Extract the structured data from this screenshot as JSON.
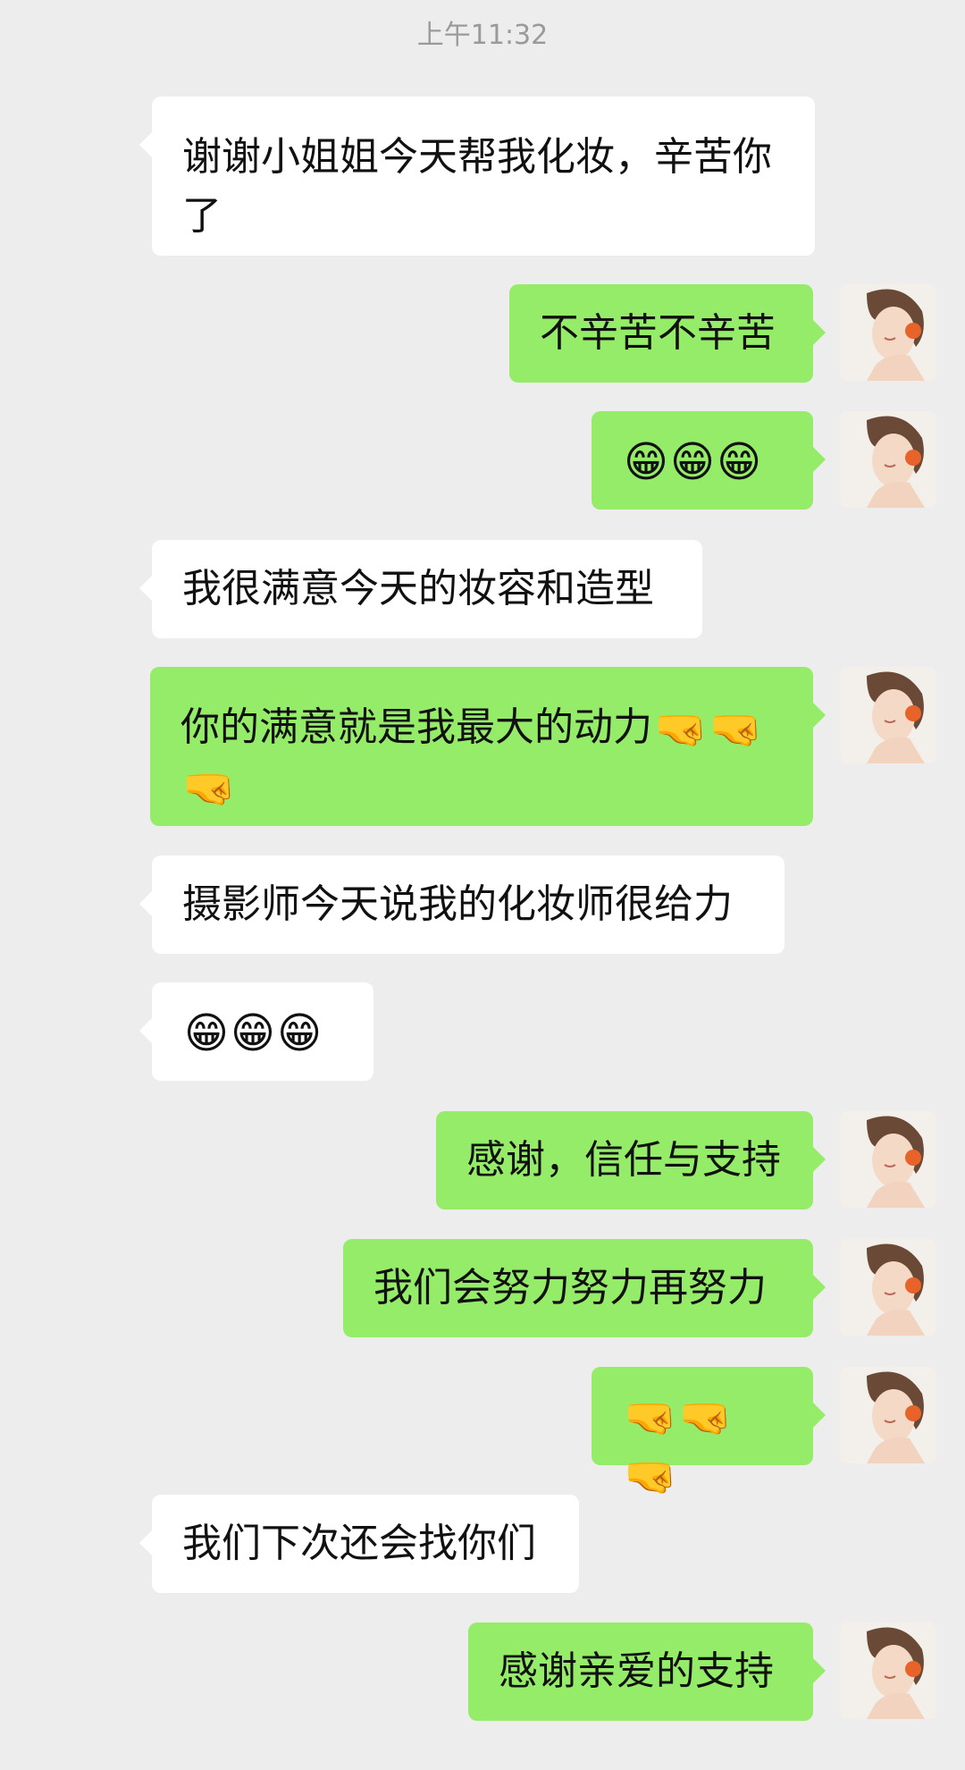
{
  "header": {
    "timestamp": "上午11:32"
  },
  "emoji_names": {
    "grin": "grinning-face-icon",
    "fight": "fighting-face-icon"
  },
  "messages": [
    {
      "side": "in",
      "text": "谢谢小姐姐今天帮我化妆，辛苦你了",
      "emojis": []
    },
    {
      "side": "out",
      "text": "不辛苦不辛苦",
      "emojis": []
    },
    {
      "side": "out",
      "text": "",
      "emojis": [
        "😁",
        "😁",
        "😁"
      ]
    },
    {
      "side": "in",
      "text": "我很满意今天的妆容和造型",
      "emojis": []
    },
    {
      "side": "out",
      "text": "你的满意就是我最大的动力",
      "emojis": [
        "🤜",
        "🤜",
        "🤜"
      ]
    },
    {
      "side": "in",
      "text": "摄影师今天说我的化妆师很给力",
      "emojis": []
    },
    {
      "side": "in",
      "text": "",
      "emojis": [
        "😁",
        "😁",
        "😁"
      ]
    },
    {
      "side": "out",
      "text": "感谢，信任与支持",
      "emojis": []
    },
    {
      "side": "out",
      "text": "我们会努力努力再努力",
      "emojis": []
    },
    {
      "side": "out",
      "text": "",
      "emojis": [
        "🤜",
        "🤜",
        "🤜"
      ]
    },
    {
      "side": "in",
      "text": "我们下次还会找你们",
      "emojis": []
    },
    {
      "side": "out",
      "text": "感谢亲爱的支持",
      "emojis": []
    }
  ],
  "colors": {
    "background": "#ededed",
    "incoming_bubble": "#ffffff",
    "outgoing_bubble": "#95ec69",
    "timestamp_text": "#9a9a9a"
  }
}
